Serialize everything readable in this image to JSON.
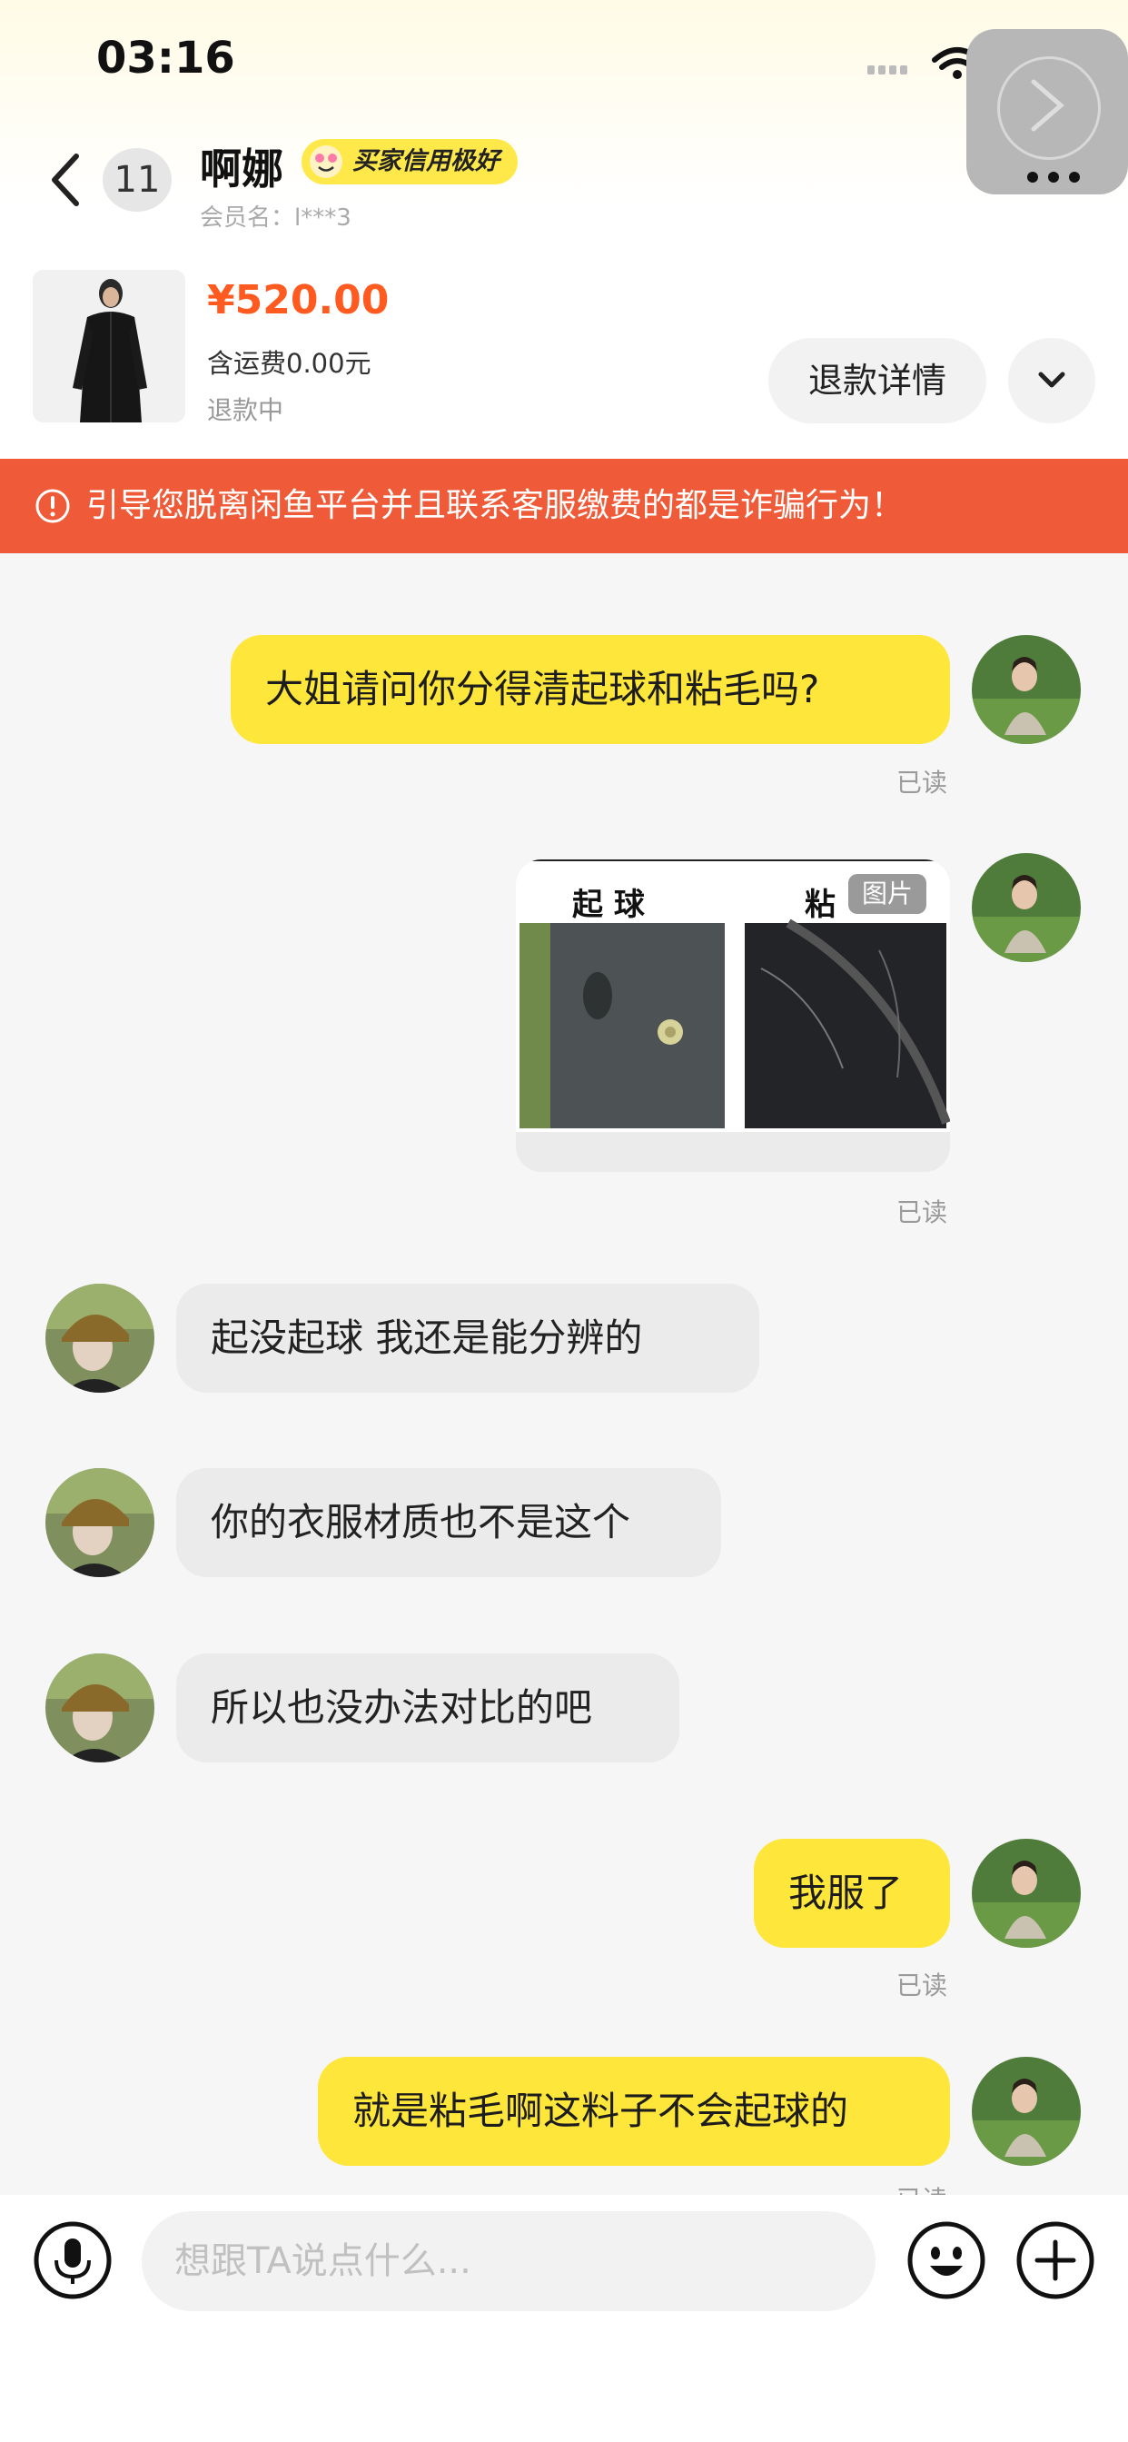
{
  "status_bar": {
    "time": "03:16"
  },
  "header": {
    "unread_count": "11",
    "username": "啊娜",
    "credit_badge": "买家信用极好",
    "member_label": "会员名：l***3"
  },
  "product": {
    "price": "¥520.00",
    "shipping": "含运费0.00元",
    "status": "退款中",
    "refund_button": "退款详情"
  },
  "warning": {
    "text": "引导您脱离闲鱼平台并且联系客服缴费的都是诈骗行为！"
  },
  "messages": [
    {
      "side": "me",
      "text": "大姐请问你分得清起球和粘毛吗?",
      "read": "已读"
    },
    {
      "side": "me",
      "type": "image",
      "image_labels": [
        "起 球",
        "粘"
      ],
      "image_tag": "图片",
      "read": "已读"
    },
    {
      "side": "them",
      "text": "起没起球 我还是能分辨的"
    },
    {
      "side": "them",
      "text": "你的衣服材质也不是这个"
    },
    {
      "side": "them",
      "text": "所以也没办法对比的吧"
    },
    {
      "side": "me",
      "text": "我服了",
      "read": "已读"
    },
    {
      "side": "me",
      "text": "就是粘毛啊这料子不会起球的",
      "read": "已读"
    }
  ],
  "input": {
    "placeholder": "想跟TA说点什么..."
  },
  "colors": {
    "accent_yellow": "#ffe63a",
    "warning_red": "#ef5b38",
    "price_orange": "#ff5a1f"
  }
}
